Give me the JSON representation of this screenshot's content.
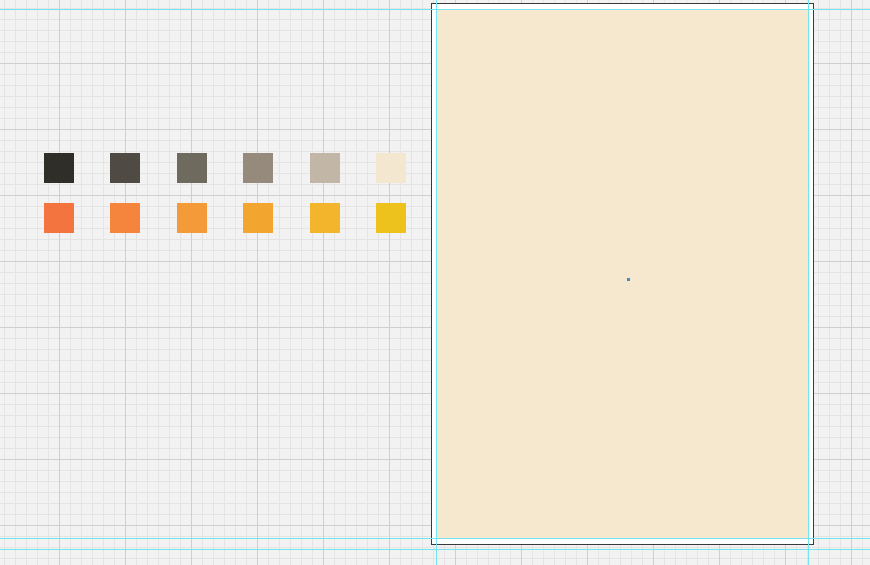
{
  "palette": {
    "row_dark": [
      "#2f2e29",
      "#4f4b44",
      "#6e6a5e",
      "#958a7c",
      "#c2b6a6",
      "#f4e7cf"
    ],
    "row_warm": [
      "#f47440",
      "#f5843d",
      "#f49a39",
      "#f2a630",
      "#f2b52b",
      "#eec21c"
    ]
  },
  "artboard": {
    "background": "#f5e8cf",
    "border": "#3a3a3a"
  },
  "guide_color": "#74e4ee",
  "icons": {
    "center_point": "center-point-icon"
  }
}
